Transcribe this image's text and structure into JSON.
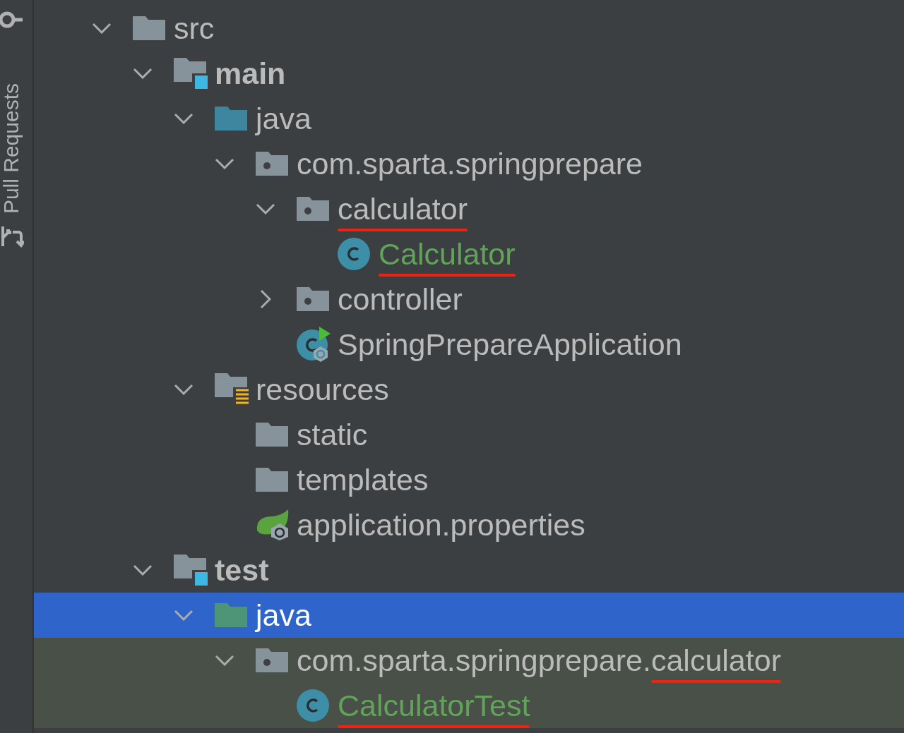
{
  "side_strip": {
    "label": "Pull Requests"
  },
  "tree": [
    {
      "label": "src",
      "kind": "folder",
      "expanded": true,
      "bold": false,
      "added": false,
      "selected": false,
      "highlighted": false,
      "underlined": false,
      "children": [
        {
          "label": "main",
          "kind": "source-root",
          "expanded": true,
          "bold": true,
          "added": false,
          "selected": false,
          "highlighted": false,
          "underlined": false,
          "children": [
            {
              "label": "java",
              "kind": "java-folder",
              "expanded": true,
              "bold": false,
              "added": false,
              "selected": false,
              "highlighted": false,
              "underlined": false,
              "children": [
                {
                  "label": "com.sparta.springprepare",
                  "kind": "package",
                  "expanded": true,
                  "bold": false,
                  "added": false,
                  "selected": false,
                  "highlighted": false,
                  "underlined": false,
                  "children": [
                    {
                      "label": "calculator",
                      "kind": "package",
                      "expanded": true,
                      "bold": false,
                      "added": false,
                      "selected": false,
                      "highlighted": false,
                      "underlined": true,
                      "children": [
                        {
                          "label": "Calculator",
                          "kind": "class",
                          "bold": false,
                          "added": true,
                          "selected": false,
                          "highlighted": false,
                          "underlined": true
                        }
                      ]
                    },
                    {
                      "label": "controller",
                      "kind": "package",
                      "expanded": false,
                      "bold": false,
                      "added": false,
                      "selected": false,
                      "highlighted": false,
                      "underlined": false
                    },
                    {
                      "label": "SpringPrepareApplication",
                      "kind": "spring-app",
                      "bold": false,
                      "added": false,
                      "selected": false,
                      "highlighted": false,
                      "underlined": false
                    }
                  ]
                }
              ]
            },
            {
              "label": "resources",
              "kind": "resources-folder",
              "expanded": true,
              "bold": false,
              "added": false,
              "selected": false,
              "highlighted": false,
              "underlined": false,
              "children": [
                {
                  "label": "static",
                  "kind": "folder",
                  "bold": false,
                  "added": false,
                  "selected": false,
                  "highlighted": false,
                  "underlined": false
                },
                {
                  "label": "templates",
                  "kind": "folder",
                  "bold": false,
                  "added": false,
                  "selected": false,
                  "highlighted": false,
                  "underlined": false
                },
                {
                  "label": "application.properties",
                  "kind": "spring-properties",
                  "bold": false,
                  "added": false,
                  "selected": false,
                  "highlighted": false,
                  "underlined": false
                }
              ]
            }
          ]
        },
        {
          "label": "test",
          "kind": "source-root",
          "expanded": true,
          "bold": true,
          "added": false,
          "selected": false,
          "highlighted": false,
          "underlined": false,
          "children": [
            {
              "label": "java",
              "kind": "test-folder",
              "expanded": true,
              "bold": false,
              "added": false,
              "selected": true,
              "highlighted": false,
              "underlined": false,
              "children": [
                {
                  "label": "com.sparta.springprepare.",
                  "label_end": "calculator",
                  "kind": "package",
                  "expanded": true,
                  "bold": false,
                  "added": false,
                  "selected": false,
                  "highlighted": true,
                  "underlined": true,
                  "children": [
                    {
                      "label": "CalculatorTest",
                      "kind": "class",
                      "bold": false,
                      "added": true,
                      "selected": false,
                      "highlighted": true,
                      "underlined": true
                    }
                  ]
                }
              ]
            }
          ]
        }
      ]
    }
  ]
}
